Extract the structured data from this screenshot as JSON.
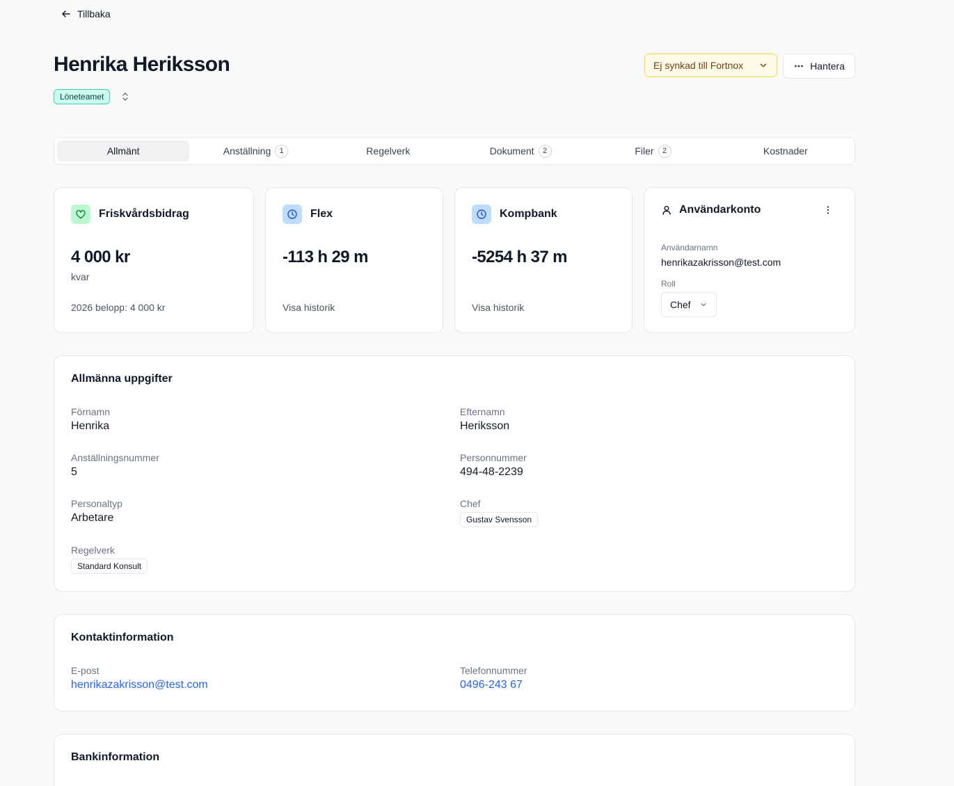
{
  "nav": {
    "back_label": "Tillbaka"
  },
  "header": {
    "name": "Henrika Heriksson",
    "team": "Löneteamet",
    "sync_label": "Ej synkad till Fortnox",
    "manage_label": "Hantera"
  },
  "tabs": [
    {
      "label": "Allmänt",
      "count": ""
    },
    {
      "label": "Anställning",
      "count": "1"
    },
    {
      "label": "Regelverk",
      "count": ""
    },
    {
      "label": "Dokument",
      "count": "2"
    },
    {
      "label": "Filer",
      "count": "2"
    },
    {
      "label": "Kostnader",
      "count": ""
    }
  ],
  "stats": {
    "wellness": {
      "title": "Friskvårdsbidrag",
      "value": "4 000 kr",
      "sub": "kvar",
      "foot": "2026 belopp: 4 000 kr"
    },
    "flex": {
      "title": "Flex",
      "value": "-113 h 29 m",
      "link": "Visa historik"
    },
    "kompbank": {
      "title": "Kompbank",
      "value": "-5254 h 37 m",
      "link": "Visa historik"
    }
  },
  "account": {
    "title": "Användarkonto",
    "username_label": "Användarnamn",
    "username": "henrikazakrisson@test.com",
    "role_label": "Roll",
    "role": "Chef"
  },
  "general": {
    "title": "Allmänna uppgifter",
    "first_name_label": "Förnamn",
    "first_name": "Henrika",
    "last_name_label": "Efternamn",
    "last_name": "Heriksson",
    "emp_no_label": "Anställningsnummer",
    "emp_no": "5",
    "personnr_label": "Personnummer",
    "personnr": "494-48-2239",
    "staff_type_label": "Personaltyp",
    "staff_type": "Arbetare",
    "manager_label": "Chef",
    "manager": "Gustav Svensson",
    "ruleset_label": "Regelverk",
    "ruleset": "Standard Konsult"
  },
  "contact": {
    "title": "Kontaktinformation",
    "email_label": "E-post",
    "email": "henrikazakrisson@test.com",
    "phone_label": "Telefonnummer",
    "phone": "0496-243 67"
  },
  "bank": {
    "title": "Bankinformation"
  },
  "colors": {
    "accent": "#2563eb",
    "team_badge": "#ccfbef",
    "sync_warning": "#fefce8"
  }
}
